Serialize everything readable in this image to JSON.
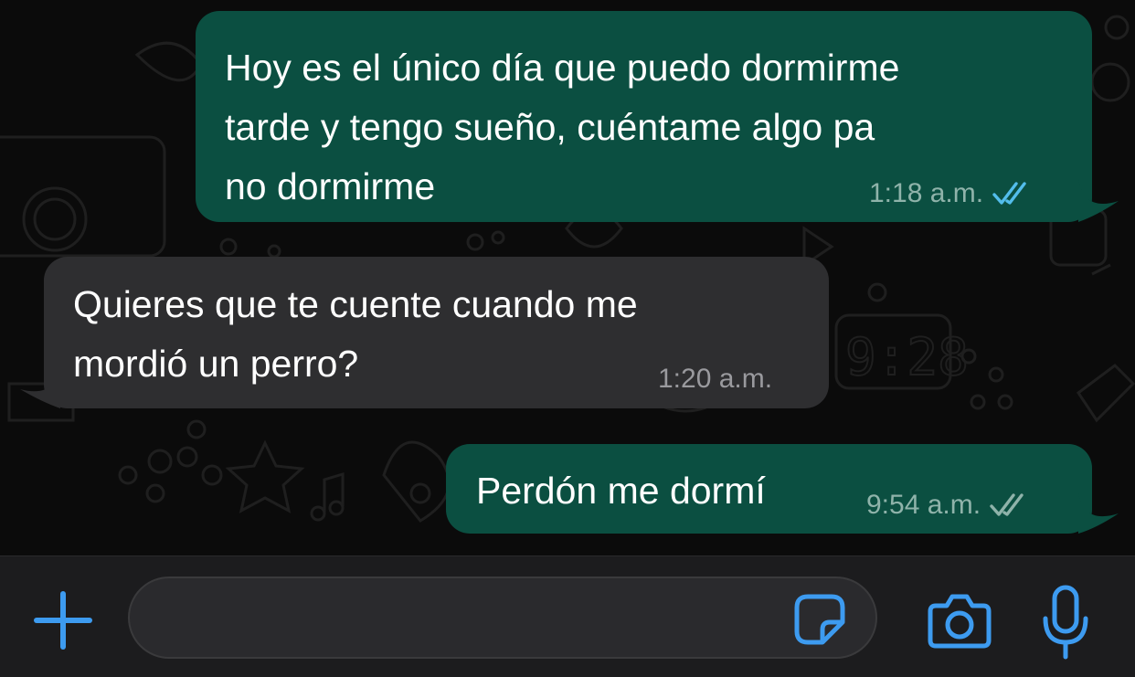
{
  "chat": {
    "messages": [
      {
        "direction": "outgoing",
        "lines": [
          "Hoy es el único día que puedo dormirme",
          "tarde y tengo sueño, cuéntame algo pa",
          "no dormirme"
        ],
        "time": "1:18 a.m.",
        "status": "read",
        "status_icon": "double-check-icon",
        "status_color": "#53bdeb"
      },
      {
        "direction": "incoming",
        "lines": [
          "Quieres que te cuente cuando me",
          "mordió un perro?"
        ],
        "time": "1:20 a.m."
      },
      {
        "direction": "outgoing",
        "lines": [
          "Perdón me dormí"
        ],
        "time": "9:54 a.m.",
        "status": "delivered",
        "status_icon": "double-check-icon",
        "status_color": "#8fb3aa"
      }
    ]
  },
  "input_bar": {
    "placeholder": "",
    "value": "",
    "icons": {
      "add": "plus-icon",
      "sticker": "sticker-icon",
      "camera": "camera-icon",
      "microphone": "microphone-icon"
    }
  },
  "colors": {
    "outgoing_bubble": "#0b4f41",
    "incoming_bubble": "#2e2e30",
    "accent": "#3d9bf0",
    "background": "#0b0b0b"
  }
}
